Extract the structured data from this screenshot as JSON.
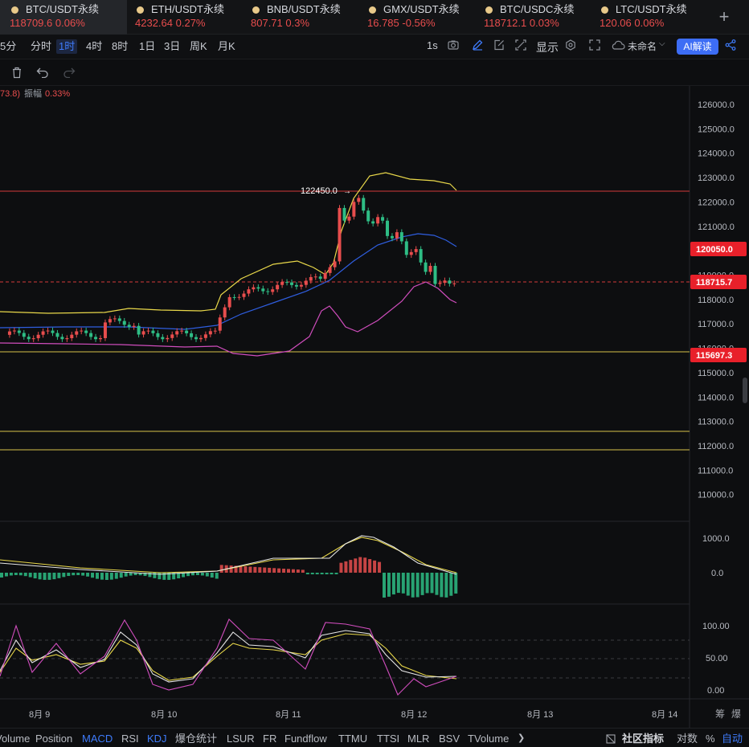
{
  "tickers": [
    {
      "symbol": "BTC/USDT永续",
      "price": "118709.6",
      "change": "0.06%"
    },
    {
      "symbol": "ETH/USDT永续",
      "price": "4232.64",
      "change": "0.27%"
    },
    {
      "symbol": "BNB/USDT永续",
      "price": "807.71",
      "change": "0.3%"
    },
    {
      "symbol": "GMX/USDT永续",
      "price": "16.785",
      "change": "-0.56%"
    },
    {
      "symbol": "BTC/USDC永续",
      "price": "118712.1",
      "change": "0.03%"
    },
    {
      "symbol": "LTC/USDT永续",
      "price": "120.06",
      "change": "0.06%"
    }
  ],
  "toolbar": {
    "timeframes": [
      "5分",
      "分时",
      "1时",
      "4时",
      "8时",
      "1日",
      "3日",
      "周K",
      "月K"
    ],
    "selected_timeframe": "1时",
    "interval_label": "1s",
    "display_label": "显示",
    "layout_name": "未命名",
    "ai_label": "AI解读"
  },
  "info": {
    "prefix": "73.8)",
    "amplitude_label": "振幅",
    "amplitude_value": "0.33%"
  },
  "price_axis": {
    "ticks": [
      "126000.0",
      "125000.0",
      "124000.0",
      "123000.0",
      "122000.0",
      "121000.0",
      "120000.0",
      "119000.0",
      "118000.0",
      "117000.0",
      "116000.0",
      "115000.0",
      "114000.0",
      "113000.0",
      "112000.0",
      "111000.0",
      "110000.0"
    ],
    "labels": [
      {
        "value": "120050.0",
        "color": "#e8202a"
      },
      {
        "value": "118715.7",
        "color": "#e8202a"
      },
      {
        "value": "115697.3",
        "color": "#e8202a"
      }
    ],
    "high_marker": "122450.0"
  },
  "macd_axis": [
    "1000.0",
    "0.0"
  ],
  "kdj_axis": [
    "100.00",
    "50.00",
    "0.00"
  ],
  "date_axis": [
    "8月 9",
    "8月 10",
    "8月 11",
    "8月 12",
    "8月 13",
    "8月 14"
  ],
  "corner_labels": {
    "a": "筹",
    "b": "爆"
  },
  "footer": {
    "indicators": [
      "Volume",
      "Position",
      "MACD",
      "RSI",
      "KDJ",
      "爆仓统计",
      "LSUR",
      "FR",
      "Fundflow",
      "TTMU",
      "TTSI",
      "MLR",
      "BSV",
      "TVolume"
    ],
    "selected": [
      "MACD",
      "KDJ"
    ],
    "community_label": "社区指标",
    "log_label": "对数",
    "pct_label": "%",
    "auto_label": "自动"
  },
  "colors": {
    "up": "#e84d4d",
    "down": "#2ebd85",
    "accent": "#3e7bfa",
    "bg": "#0d0e10"
  }
}
